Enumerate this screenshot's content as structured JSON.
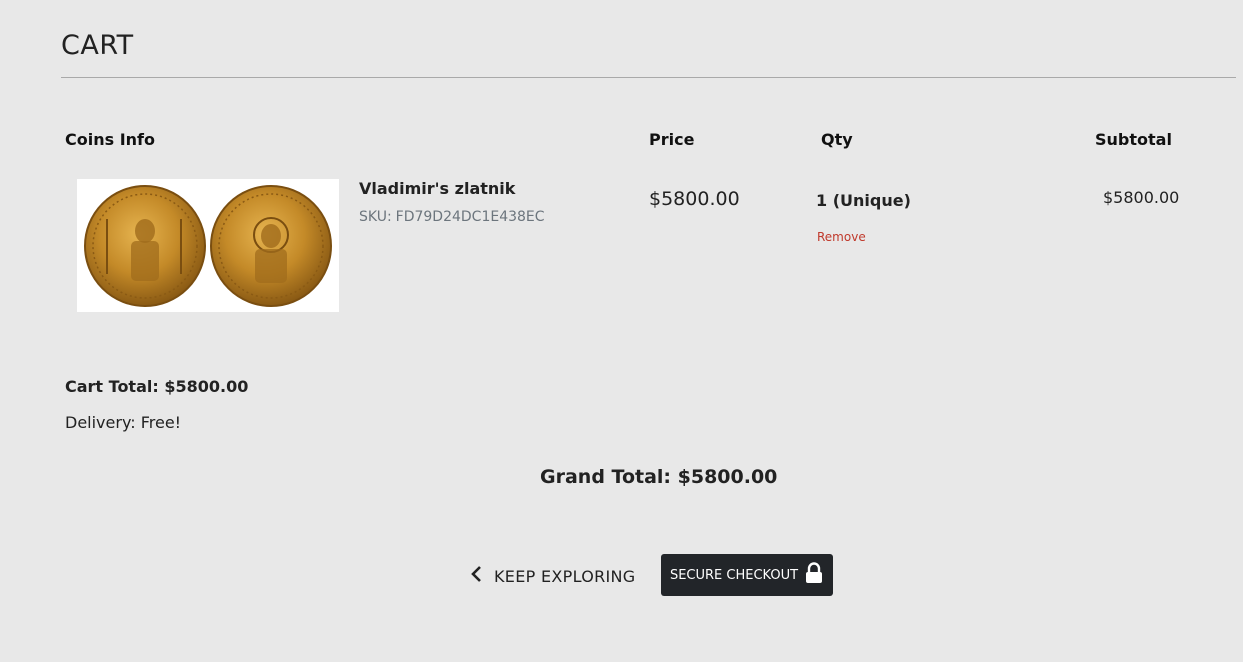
{
  "header": {
    "title": "CART"
  },
  "table": {
    "columns": {
      "info": "Coins Info",
      "price": "Price",
      "qty": "Qty",
      "subtotal": "Subtotal"
    }
  },
  "items": [
    {
      "name": "Vladimir's zlatnik",
      "sku_label": "SKU:",
      "sku": "FD79D24DC1E438EC",
      "price": "$5800.00",
      "qty": "1 (Unique)",
      "remove_label": "Remove",
      "subtotal": "$5800.00",
      "image_icon": "gold-coin-image"
    }
  ],
  "summary": {
    "cart_total": "Cart Total: $5800.00",
    "delivery": "Delivery: Free!",
    "grand_total": "Grand Total: $5800.00"
  },
  "actions": {
    "keep_exploring": "KEEP EXPLORING",
    "keep_exploring_icon": "chevron-left-icon",
    "checkout": "SECURE CHECKOUT",
    "checkout_icon": "lock-icon"
  },
  "colors": {
    "background": "#e8e8e8",
    "remove_link": "#c0392b",
    "checkout_button": "#222529",
    "coin_gold": "#c08a2c"
  }
}
